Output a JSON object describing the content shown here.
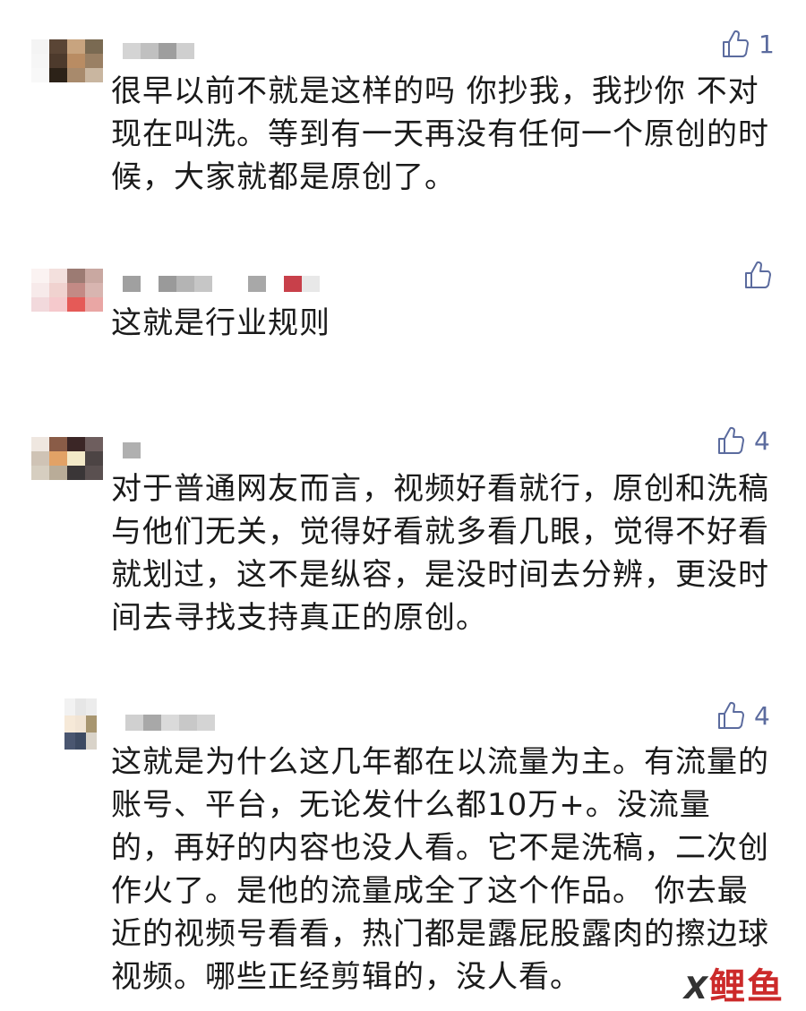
{
  "comments": [
    {
      "likes": "1",
      "text": "很早以前不就是这样的吗 你抄我，我抄你 不对 现在叫洗。等到有一天再没有任何一个原创的时候，大家就都是原创了。",
      "avatar_colors": [
        "#f4f4f4",
        "#5a4535",
        "#c8a47f",
        "#7a6a52",
        "#f6f6f6",
        "#4d3a2c",
        "#b98c63",
        "#9a8064",
        "#f8f8f8",
        "#2c2218",
        "#a88a6c",
        "#c9b6a0",
        "#ffffff",
        "#ffffff",
        "#ffffff",
        "#ffffff"
      ],
      "name_colors": [
        "#d4d4d4",
        "#c0c0c0",
        "#9e9e9e",
        "#cfcfcf"
      ]
    },
    {
      "likes": "",
      "text": "这就是行业规则",
      "avatar_colors": [
        "#fbf3f2",
        "#f3e0dd",
        "#9c7b73",
        "#c9a8a1",
        "#f7eaea",
        "#f0d2cf",
        "#c38a85",
        "#d8b5b0",
        "#f2d9dc",
        "#f5c9cc",
        "#e55a57",
        "#e9a6a4",
        "#ffffff",
        "#ffffff",
        "#ffffff",
        "#ffffff"
      ],
      "name_colors": [
        "#a0a0a0",
        "#ffffff",
        "#9a9a9a",
        "#b4b4b4",
        "#c6c6c6",
        "#ffffff",
        "#ffffff",
        "#a8a8a8",
        "#ffffff",
        "#c8404a",
        "#e8e8e8"
      ]
    },
    {
      "likes": "4",
      "text": "对于普通网友而言，视频好看就行，原创和洗稿与他们无关，觉得好看就多看几眼，觉得不好看就划过，这不是纵容，是没时间去分辨，更没时间去寻找支持真正的原创。",
      "avatar_colors": [
        "#efe7e0",
        "#8a5c47",
        "#3b2626",
        "#6e5e5e",
        "#cfc3b5",
        "#e2a266",
        "#f3e9c8",
        "#4c4444",
        "#d6cec0",
        "#b9ac98",
        "#3a3637",
        "#5a5050",
        "#ffffff",
        "#ffffff",
        "#ffffff",
        "#ffffff"
      ],
      "name_colors": [
        "#b0b0b0"
      ]
    },
    {
      "likes": "4",
      "text": "这就是为什么这几年都在以流量为主。有流量的账号、平台，无论发什么都10万+。没流量的，再好的内容也没人看。它不是洗稿，二次创作火了。是他的流量成全了这个作品。  你去最近的视频号看看，热门都是露屁股露肉的擦边球视频。哪些正经剪辑的，没人看。",
      "avatar_colors": [
        "#ffffff",
        "#f2f2f2",
        "#e6e6e6",
        "#ececec",
        "#ffffff",
        "#f6e9d8",
        "#f1e4d4",
        "#a89670",
        "#ffffff",
        "#4a5670",
        "#3d4a62",
        "#d9d3c9",
        "#ffffff",
        "#ffffff",
        "#ffffff",
        "#ffffff"
      ],
      "name_colors": [
        "#d0d0d0",
        "#a8a8a8",
        "#dadada",
        "#c8c8c8",
        "#d4d4d4"
      ]
    }
  ],
  "watermark": {
    "prefix": "X",
    "text": "鲤鱼"
  }
}
